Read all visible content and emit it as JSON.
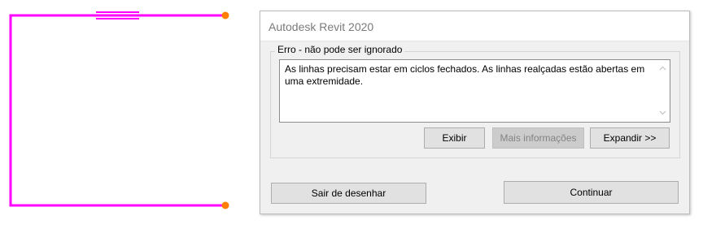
{
  "dialog": {
    "title": "Autodesk Revit 2020",
    "group_label": "Erro - não pode ser ignorado",
    "message": "As linhas precisam estar em ciclos fechados. As linhas realçadas estão abertas em uma extremidade.",
    "buttons": {
      "show": "Exibir",
      "more_info": "Mais informações",
      "expand": "Expandir >>",
      "quit_sketch": "Sair de desenhar",
      "continue": "Continuar"
    }
  },
  "colors": {
    "sketch_line": "#ff00ff",
    "endpoint": "#ff8000"
  }
}
